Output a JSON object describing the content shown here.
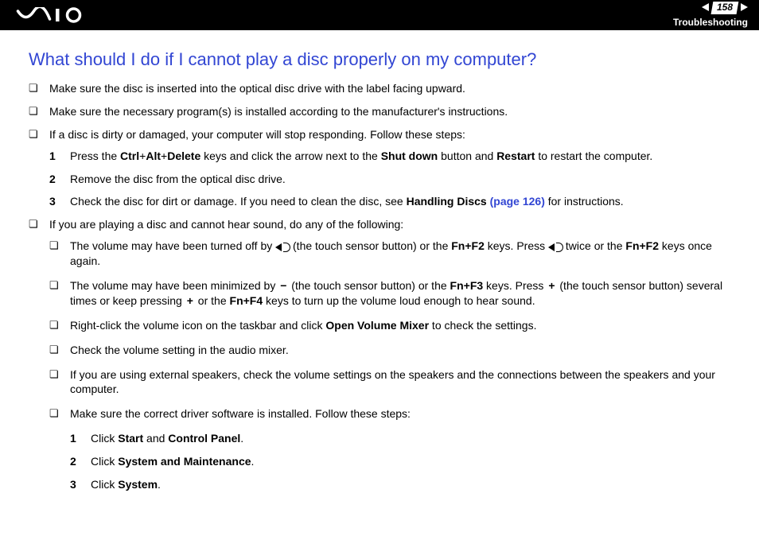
{
  "header": {
    "page_number": "158",
    "section": "Troubleshooting"
  },
  "title": "What should I do if I cannot play a disc properly on my computer?",
  "bullets": {
    "b1": "Make sure the disc is inserted into the optical disc drive with the label facing upward.",
    "b2": "Make sure the necessary program(s) is installed according to the manufacturer's instructions.",
    "b3": "If a disc is dirty or damaged, your computer will stop responding. Follow these steps:",
    "b4": "If you are playing a disc and cannot hear sound, do any of the following:"
  },
  "steps1": {
    "s1_pre": "Press the ",
    "s1_ctrl": "Ctrl",
    "s1_plus1": "+",
    "s1_alt": "Alt",
    "s1_plus2": "+",
    "s1_del": "Delete",
    "s1_mid": " keys and click the arrow next to the ",
    "s1_shut": "Shut down",
    "s1_mid2": " button and ",
    "s1_restart": "Restart",
    "s1_post": " to restart the computer.",
    "s2": "Remove the disc from the optical disc drive.",
    "s3_pre": "Check the disc for dirt or damage. If you need to clean the disc, see ",
    "s3_bold": "Handling Discs ",
    "s3_link": "(page 126)",
    "s3_post": " for instructions."
  },
  "sub": {
    "a_pre": "The volume may have been turned off by ",
    "a_mid": " (the touch sensor button) or the ",
    "a_fnf2": "Fn+F2",
    "a_mid2": " keys. Press ",
    "a_post": " twice or the ",
    "a_fnf2b": "Fn+F2",
    "a_end": " keys once again.",
    "b_pre": "The volume may have been minimized by ",
    "b_minus": "−",
    "b_mid": " (the touch sensor button) or the ",
    "b_fnf3": "Fn+F3",
    "b_mid2": " keys. Press ",
    "b_plus": "+",
    "b_mid3": " (the touch sensor button) several times or keep pressing ",
    "b_plus2": "+",
    "b_mid4": " or the ",
    "b_fnf4": "Fn+F4",
    "b_end": " keys to turn up the volume loud enough to hear sound.",
    "c_pre": "Right-click the volume icon on the taskbar and click ",
    "c_bold": "Open Volume Mixer",
    "c_post": " to check the settings.",
    "d": "Check the volume setting in the audio mixer.",
    "e": "If you are using external speakers, check the volume settings on the speakers and the connections between the speakers and your computer.",
    "f": "Make sure the correct driver software is installed. Follow these steps:"
  },
  "steps2": {
    "s1_pre": "Click ",
    "s1_start": "Start",
    "s1_and": " and ",
    "s1_cp": "Control Panel",
    "s1_dot": ".",
    "s2_pre": "Click ",
    "s2_sm": "System and Maintenance",
    "s2_dot": ".",
    "s3_pre": "Click ",
    "s3_sys": "System",
    "s3_dot": "."
  }
}
